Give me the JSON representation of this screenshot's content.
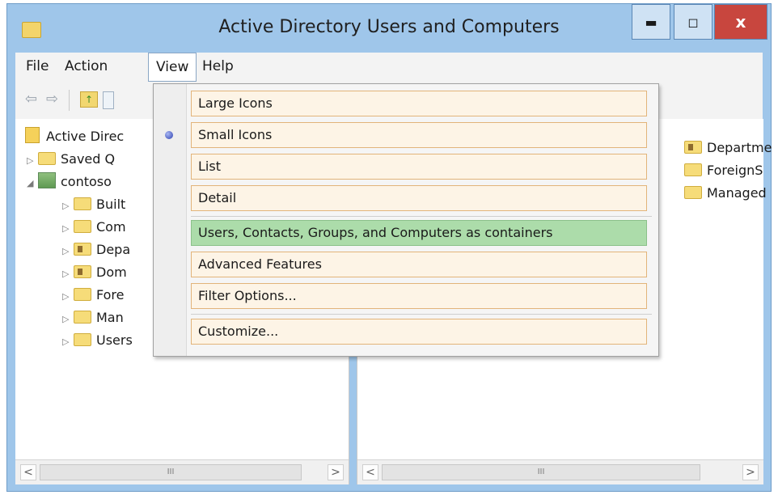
{
  "window": {
    "title": "Active Directory Users and Computers",
    "controls": {
      "minimize": "▬",
      "maximize": "◻",
      "close": "x"
    }
  },
  "menubar": {
    "items": [
      "File",
      "Action",
      "View",
      "Help"
    ]
  },
  "left_pane": {
    "tree": [
      {
        "label": "Active Direc",
        "icon": "ad-snapin-icon"
      },
      {
        "label": "Saved Q",
        "icon": "folder-icon"
      },
      {
        "label": "contoso",
        "icon": "domain-icon"
      },
      {
        "label": "Built",
        "icon": "folder-icon"
      },
      {
        "label": "Com",
        "icon": "folder-icon"
      },
      {
        "label": "Depa",
        "icon": "ou-icon"
      },
      {
        "label": "Dom",
        "icon": "ou-icon"
      },
      {
        "label": "Fore",
        "icon": "folder-icon"
      },
      {
        "label": "Man",
        "icon": "folder-icon"
      },
      {
        "label": "Users",
        "icon": "folder-icon"
      }
    ],
    "scroll_thumb": "III"
  },
  "right_pane": {
    "items": [
      {
        "label": "Departme",
        "icon": "ou-icon"
      },
      {
        "label": "ForeignS",
        "icon": "folder-icon"
      },
      {
        "label": "Managed",
        "icon": "folder-icon"
      }
    ],
    "scroll_thumb": "III"
  },
  "view_menu": {
    "items": [
      "Large Icons",
      "Small Icons",
      "List",
      "Detail",
      "Users, Contacts, Groups, and Computers as containers",
      "Advanced Features",
      "Filter Options...",
      "Customize..."
    ],
    "selected_view": "Small Icons",
    "hover_item": "Users, Contacts, Groups, and Computers as containers"
  },
  "scroll": {
    "left": "<",
    "right": ">"
  }
}
